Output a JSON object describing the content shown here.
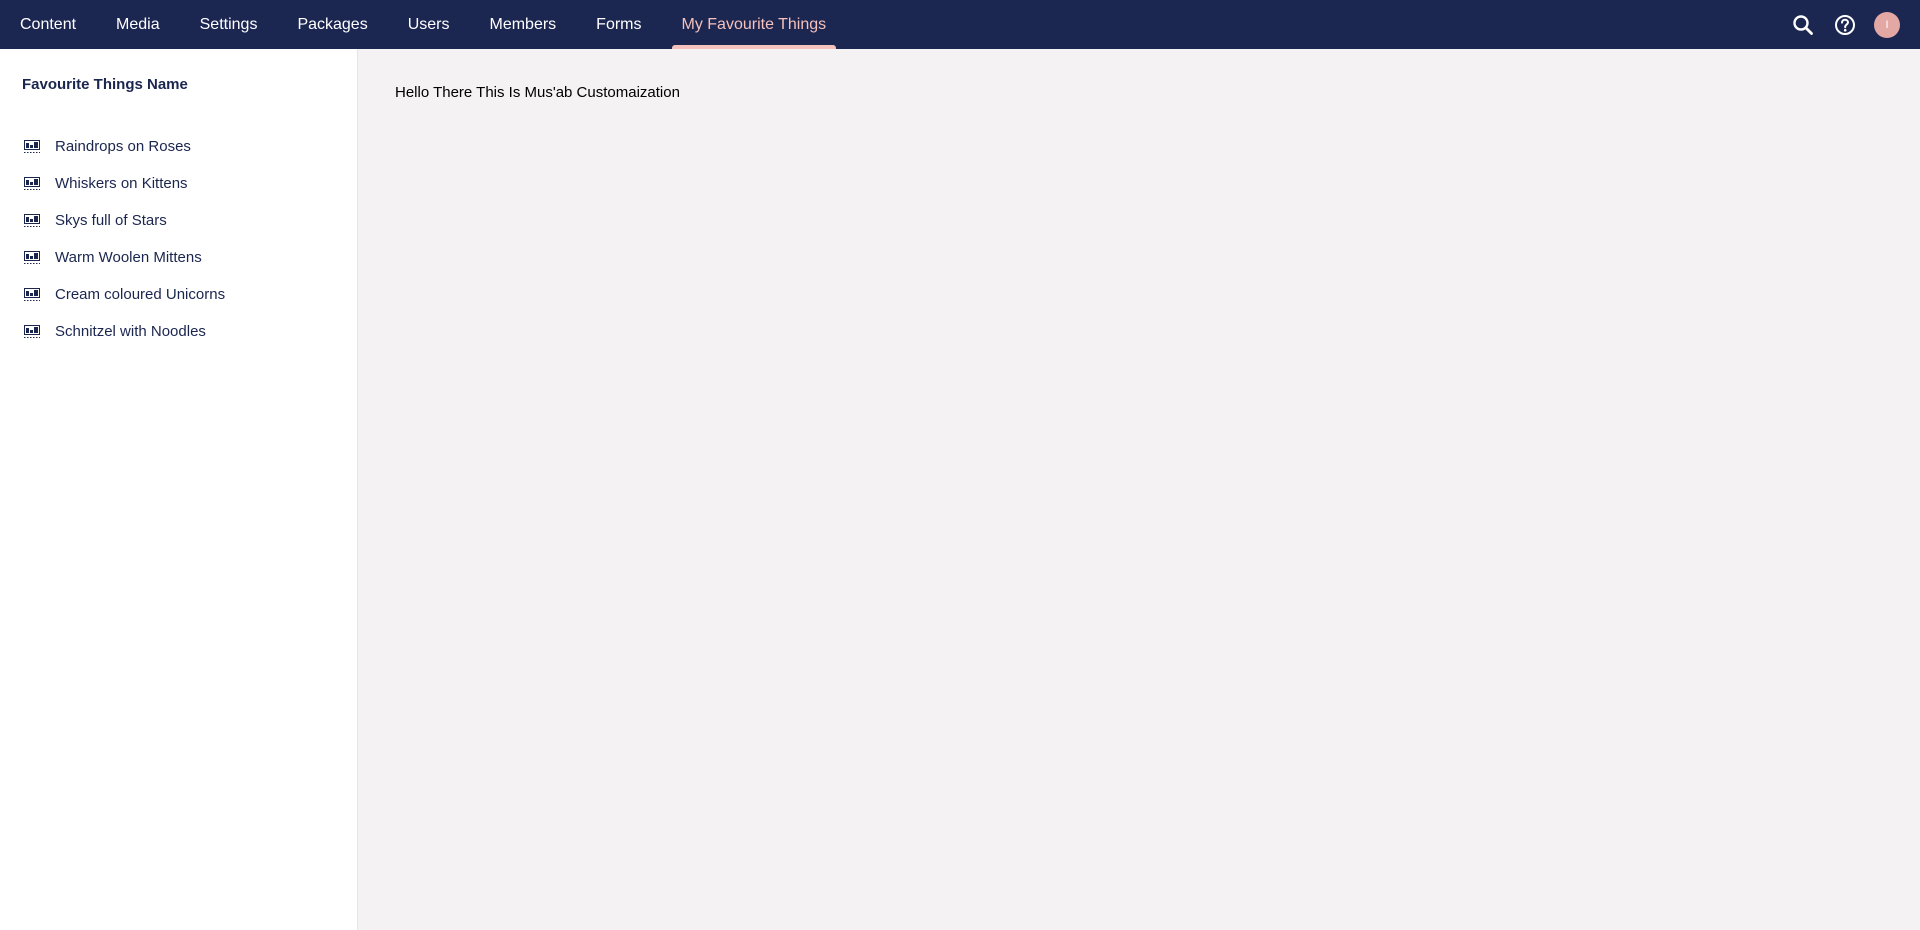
{
  "nav": {
    "items": [
      {
        "label": "Content"
      },
      {
        "label": "Media"
      },
      {
        "label": "Settings"
      },
      {
        "label": "Packages"
      },
      {
        "label": "Users"
      },
      {
        "label": "Members"
      },
      {
        "label": "Forms"
      },
      {
        "label": "My Favourite Things"
      }
    ],
    "active_index": 7
  },
  "tools": {
    "search_icon": "search-icon",
    "help_icon": "help-icon",
    "avatar_initial": "I"
  },
  "sidebar": {
    "title": "Favourite Things Name",
    "items": [
      {
        "label": "Raindrops on Roses",
        "icon": "document-icon"
      },
      {
        "label": "Whiskers on Kittens",
        "icon": "document-icon"
      },
      {
        "label": "Skys full of Stars",
        "icon": "document-icon"
      },
      {
        "label": "Warm Woolen Mittens",
        "icon": "document-icon"
      },
      {
        "label": "Cream coloured Unicorns",
        "icon": "document-icon"
      },
      {
        "label": "Schnitzel with Noodles",
        "icon": "document-icon"
      }
    ]
  },
  "main": {
    "greeting": "Hello There This Is Mus'ab Customaization"
  },
  "colors": {
    "header_bg": "#1b2651",
    "active_accent": "#f5c1bc",
    "sidebar_bg": "#ffffff",
    "main_bg": "#f4f2f3",
    "avatar_bg": "#e3a7a4"
  }
}
